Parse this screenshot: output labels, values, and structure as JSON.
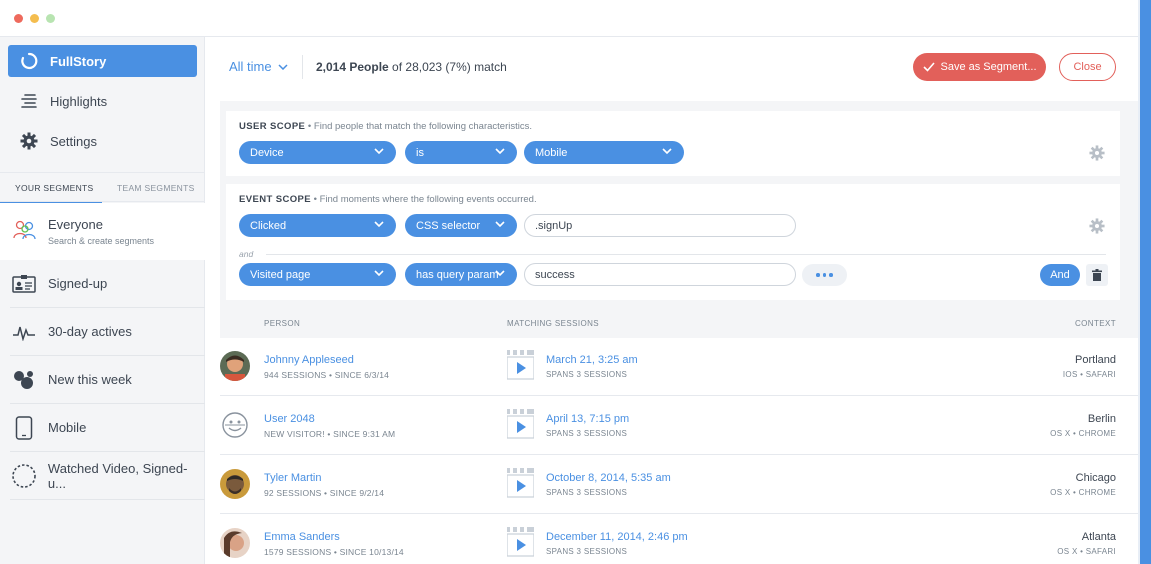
{
  "app": {
    "brand_color": "#4a90e2",
    "accent_red": "#e2605a"
  },
  "window": {
    "buttons": [
      "close",
      "minimize",
      "maximize"
    ]
  },
  "sidebar": {
    "nav": [
      {
        "label": "FullStory",
        "icon": "fullstory-logo-icon",
        "active": true
      },
      {
        "label": "Highlights",
        "icon": "highlights-icon",
        "active": false
      },
      {
        "label": "Settings",
        "icon": "gear-icon",
        "active": false
      }
    ],
    "tabs": {
      "yours": "YOUR SEGMENTS",
      "team": "TEAM SEGMENTS"
    },
    "everyone": {
      "label": "Everyone",
      "sub": "Search & create segments",
      "icon": "people-icon"
    },
    "segments": [
      {
        "label": "Signed-up",
        "icon": "id-card-icon"
      },
      {
        "label": "30-day actives",
        "icon": "pulse-icon"
      },
      {
        "label": "New this week",
        "icon": "bubbles-icon"
      },
      {
        "label": "Mobile",
        "icon": "tablet-icon"
      },
      {
        "label": "Watched Video, Signed-u...",
        "icon": "dashed-circle-icon"
      }
    ]
  },
  "topbar": {
    "range": "All time",
    "match_count": "2,014 People",
    "match_rest": " of 28,023 (7%) match",
    "save_label": "Save as Segment...",
    "close_label": "Close"
  },
  "user_scope": {
    "title": "USER SCOPE",
    "desc": " • Find people that match the following characteristics.",
    "field": "Device",
    "op": "is",
    "value": "Mobile"
  },
  "event_scope": {
    "title": "EVENT SCOPE",
    "desc": " • Find moments where the following events occurred.",
    "row1": {
      "event": "Clicked",
      "op": "CSS selector",
      "value": ".signUp"
    },
    "and_label": "and",
    "row2": {
      "event": "Visited page",
      "op": "has query param",
      "value": "success"
    },
    "and_button": "And"
  },
  "results": {
    "headers": {
      "person": "PERSON",
      "sessions": "MATCHING SESSIONS",
      "context": "CONTEXT"
    },
    "rows": [
      {
        "name": "Johnny Appleseed",
        "meta": "944 SESSIONS • SINCE 6/3/14",
        "date": "March 21, 3:25 am",
        "spans": "SPANS 3 SESSIONS",
        "city": "Portland",
        "platform": "IOS • SAFARI"
      },
      {
        "name": "User 2048",
        "meta": "NEW VISITOR! • SINCE 9:31 AM",
        "date": "April 13, 7:15 pm",
        "spans": "SPANS 3 SESSIONS",
        "city": "Berlin",
        "platform": "OS X • CHROME"
      },
      {
        "name": "Tyler Martin",
        "meta": "92 SESSIONS • SINCE 9/2/14",
        "date": "October 8, 2014, 5:35 am",
        "spans": "SPANS 3 SESSIONS",
        "city": "Chicago",
        "platform": "OS X • CHROME"
      },
      {
        "name": "Emma Sanders",
        "meta": "1579 SESSIONS • SINCE 10/13/14",
        "date": "December 11, 2014, 2:46 pm",
        "spans": "SPANS 3 SESSIONS",
        "city": "Atlanta",
        "platform": "OS X • SAFARI"
      }
    ]
  }
}
